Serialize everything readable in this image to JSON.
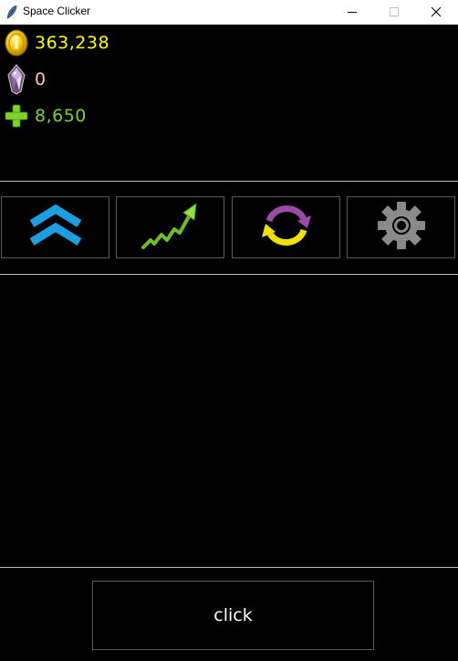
{
  "window": {
    "title": "Space Clicker",
    "icon": "feather-icon",
    "controls": [
      "minimize-icon",
      "maximize-icon",
      "close-icon"
    ]
  },
  "stats": {
    "coins": {
      "value": "363,238",
      "icon": "coin-icon",
      "color": "#ffff00"
    },
    "gems": {
      "value": "0",
      "icon": "gem-icon",
      "color": "#ffc0cb"
    },
    "bonus": {
      "value": "8,650",
      "icon": "plus-icon",
      "color": "#7fd324"
    }
  },
  "tabs": [
    {
      "name": "upgrades",
      "icon": "double-chevron-up-icon",
      "color": "#1a9fe0"
    },
    {
      "name": "stats",
      "icon": "trend-up-arrow-icon",
      "color": "#7ccd2a"
    },
    {
      "name": "rebirth",
      "icon": "cycle-arrows-icon",
      "colors": [
        "#9b4aa8",
        "#f2e000"
      ]
    },
    {
      "name": "settings",
      "icon": "gear-icon",
      "color": "#8a8a8a"
    }
  ],
  "click_button": {
    "label": "click"
  }
}
